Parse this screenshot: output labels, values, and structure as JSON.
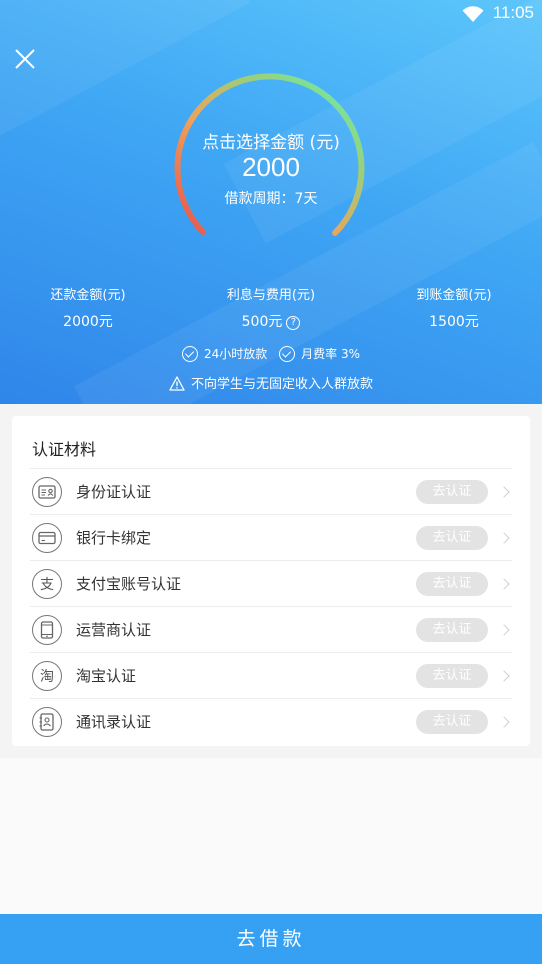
{
  "status": {
    "time": "11:05"
  },
  "gauge": {
    "title": "点击选择金额 (元)",
    "amount": "2000",
    "period": "借款周期：7天"
  },
  "stats": [
    {
      "label": "还款金额(元)",
      "value": "2000元"
    },
    {
      "label": "利息与费用(元)",
      "value": "500元"
    },
    {
      "label": "到账金额(元)",
      "value": "1500元"
    }
  ],
  "help_glyph": "?",
  "perks": [
    "24小时放款",
    "月费率 3%"
  ],
  "notice": "不向学生与无固定收入人群放款",
  "materials": {
    "title": "认证材料",
    "items": [
      {
        "label": "身份证认证",
        "action": "去认证",
        "icon": "id-card-icon"
      },
      {
        "label": "银行卡绑定",
        "action": "去认证",
        "icon": "bank-card-icon"
      },
      {
        "label": "支付宝账号认证",
        "action": "去认证",
        "icon": "alipay-icon",
        "glyph": "支"
      },
      {
        "label": "运营商认证",
        "action": "去认证",
        "icon": "phone-icon"
      },
      {
        "label": "淘宝认证",
        "action": "去认证",
        "icon": "taobao-icon",
        "glyph": "淘"
      },
      {
        "label": "通讯录认证",
        "action": "去认证",
        "icon": "contacts-icon"
      }
    ]
  },
  "submit": {
    "label": "去借款"
  },
  "colors": {
    "hero_top": "#5cc6fb",
    "hero_bottom": "#2f86e9",
    "gauge_start": "#e4534f",
    "gauge_end": "#63f0b6",
    "button": "#36a1f2"
  }
}
